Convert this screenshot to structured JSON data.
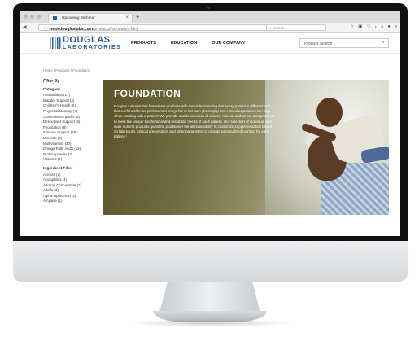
{
  "browser": {
    "tab_title": "Upcoming Webinar",
    "tab_close": "×",
    "new_tab": "+",
    "url_domain": "www.douglaslabs.com",
    "url_path": "/products/foundation.html",
    "search_placeholder": "Search",
    "nav_back": "◀",
    "nav_forward": "▶",
    "toolbar_icons": [
      "star-icon",
      "clipboard-icon",
      "pocket-icon",
      "download-icon",
      "home-icon",
      "account-icon",
      "menu-icon"
    ]
  },
  "site": {
    "logo_top": "DOUGLAS",
    "logo_bottom": "LABORATORIES",
    "nav": [
      "PRODUCTS",
      "EDUCATION",
      "OUR COMPANY"
    ],
    "product_search_placeholder": "Product Search",
    "brand_color": "#2b5f9e"
  },
  "breadcrumb": "Home | Products | Foundation",
  "sidebar": {
    "filter_title": "Filter By",
    "category_title": "Category",
    "categories": [
      "Antioxidants (17)",
      "Bladder Support (4)",
      "Children's Health (8)",
      "Cognitive/Memory (1)",
      "Convenience packs (5)",
      "Detox/Liver Support (6)",
      "Foundation (8)",
      "Immune Support (19)",
      "Minerals (2)",
      "Multivitamins (30)",
      "Omega Fatty Acids (12)",
      "Protein powder (3)",
      "Vitamins (1)"
    ],
    "ingredient_title": "Ingredient Filter",
    "ingredients": [
      "Acerola (2)",
      "Acidophilus (4)",
      "Adrenal Concentrate (1)",
      "Alfalfa (3)",
      "Alpha-Lipoic Acid (2)",
      "Amylase (1)"
    ]
  },
  "hero": {
    "title": "FOUNDATION",
    "body": "Douglas Laboratories formulates products with the understanding that every patient is different and that each healthcare professional brings his or her own philosophy and clinical experience into play when working with a patient. We provide a wide selection of vitamin, mineral and amino acid products to meet the unique biochemical and metabolic needs of each patient. Our selection of individual and multi-nutrient products gives the practitioner the ultimate ability to customize supplementation based on lab results, clinical presentation and other parameters to provide personalized nutrition for each patient.¹"
  }
}
